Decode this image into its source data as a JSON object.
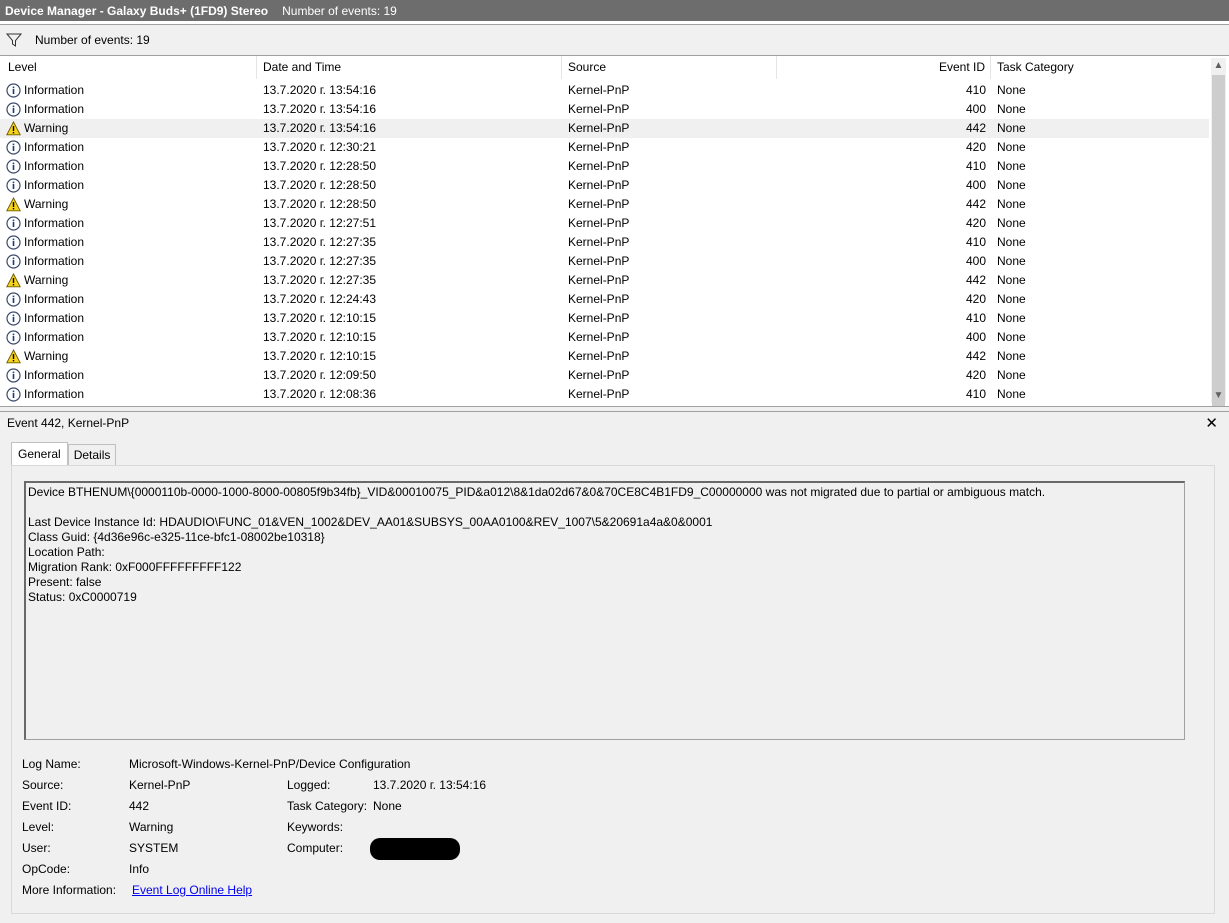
{
  "window": {
    "title": "Device Manager - Galaxy Buds+ (1FD9) Stereo",
    "title_count": "Number of events: 19"
  },
  "filter": {
    "count_label": "Number of events: 19"
  },
  "columns": {
    "level": "Level",
    "date": "Date and Time",
    "source": "Source",
    "event_id": "Event ID",
    "task": "Task Category"
  },
  "rows": [
    {
      "level": "Information",
      "date": "13.7.2020 г. 13:54:16",
      "source": "Kernel-PnP",
      "event_id": "410",
      "task": "None",
      "icon": "info-icon"
    },
    {
      "level": "Information",
      "date": "13.7.2020 г. 13:54:16",
      "source": "Kernel-PnP",
      "event_id": "400",
      "task": "None",
      "icon": "info-icon"
    },
    {
      "level": "Warning",
      "date": "13.7.2020 г. 13:54:16",
      "source": "Kernel-PnP",
      "event_id": "442",
      "task": "None",
      "icon": "warning-icon",
      "selected": true
    },
    {
      "level": "Information",
      "date": "13.7.2020 г. 12:30:21",
      "source": "Kernel-PnP",
      "event_id": "420",
      "task": "None",
      "icon": "info-icon"
    },
    {
      "level": "Information",
      "date": "13.7.2020 г. 12:28:50",
      "source": "Kernel-PnP",
      "event_id": "410",
      "task": "None",
      "icon": "info-icon"
    },
    {
      "level": "Information",
      "date": "13.7.2020 г. 12:28:50",
      "source": "Kernel-PnP",
      "event_id": "400",
      "task": "None",
      "icon": "info-icon"
    },
    {
      "level": "Warning",
      "date": "13.7.2020 г. 12:28:50",
      "source": "Kernel-PnP",
      "event_id": "442",
      "task": "None",
      "icon": "warning-icon"
    },
    {
      "level": "Information",
      "date": "13.7.2020 г. 12:27:51",
      "source": "Kernel-PnP",
      "event_id": "420",
      "task": "None",
      "icon": "info-icon"
    },
    {
      "level": "Information",
      "date": "13.7.2020 г. 12:27:35",
      "source": "Kernel-PnP",
      "event_id": "410",
      "task": "None",
      "icon": "info-icon"
    },
    {
      "level": "Information",
      "date": "13.7.2020 г. 12:27:35",
      "source": "Kernel-PnP",
      "event_id": "400",
      "task": "None",
      "icon": "info-icon"
    },
    {
      "level": "Warning",
      "date": "13.7.2020 г. 12:27:35",
      "source": "Kernel-PnP",
      "event_id": "442",
      "task": "None",
      "icon": "warning-icon"
    },
    {
      "level": "Information",
      "date": "13.7.2020 г. 12:24:43",
      "source": "Kernel-PnP",
      "event_id": "420",
      "task": "None",
      "icon": "info-icon"
    },
    {
      "level": "Information",
      "date": "13.7.2020 г. 12:10:15",
      "source": "Kernel-PnP",
      "event_id": "410",
      "task": "None",
      "icon": "info-icon"
    },
    {
      "level": "Information",
      "date": "13.7.2020 г. 12:10:15",
      "source": "Kernel-PnP",
      "event_id": "400",
      "task": "None",
      "icon": "info-icon"
    },
    {
      "level": "Warning",
      "date": "13.7.2020 г. 12:10:15",
      "source": "Kernel-PnP",
      "event_id": "442",
      "task": "None",
      "icon": "warning-icon"
    },
    {
      "level": "Information",
      "date": "13.7.2020 г. 12:09:50",
      "source": "Kernel-PnP",
      "event_id": "420",
      "task": "None",
      "icon": "info-icon"
    },
    {
      "level": "Information",
      "date": "13.7.2020 г. 12:08:36",
      "source": "Kernel-PnP",
      "event_id": "410",
      "task": "None",
      "icon": "info-icon"
    }
  ],
  "detail": {
    "title": "Event 442, Kernel-PnP",
    "close": "✕",
    "tabs": [
      "General",
      "Details"
    ],
    "description": {
      "line1": "Device BTHENUM\\{0000110b-0000-1000-8000-00805f9b34fb}_VID&00010075_PID&a012\\8&1da02d67&0&70CE8C4B1FD9_C00000000 was not migrated due to partial or ambiguous match.",
      "line2": "Last Device Instance Id: HDAUDIO\\FUNC_01&VEN_1002&DEV_AA01&SUBSYS_00AA0100&REV_1007\\5&20691a4a&0&0001",
      "line3": "Class Guid: {4d36e96c-e325-11ce-bfc1-08002be10318}",
      "line4": "Location Path:",
      "line5": "Migration Rank: 0xF000FFFFFFFFF122",
      "line6": "Present: false",
      "line7": "Status: 0xC0000719"
    },
    "props": {
      "log_name_label": "Log Name:",
      "log_name": "Microsoft-Windows-Kernel-PnP/Device Configuration",
      "source_label": "Source:",
      "source": "Kernel-PnP",
      "logged_label": "Logged:",
      "logged": "13.7.2020 г. 13:54:16",
      "event_id_label": "Event ID:",
      "event_id": "442",
      "task_label": "Task Category:",
      "task": "None",
      "level_label": "Level:",
      "level": "Warning",
      "keywords_label": "Keywords:",
      "user_label": "User:",
      "user": "SYSTEM",
      "computer_label": "Computer:",
      "opcode_label": "OpCode:",
      "opcode": "Info",
      "more_info_label": "More Information:",
      "more_info_link": "Event Log Online Help"
    }
  }
}
